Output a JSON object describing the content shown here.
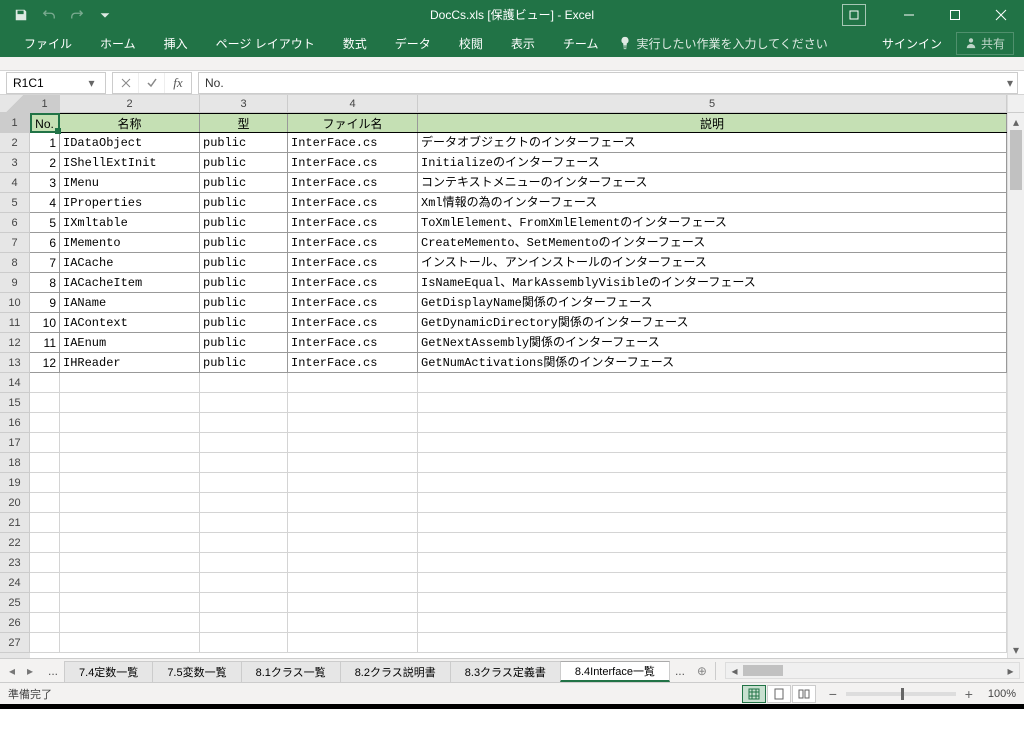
{
  "title": "DocCs.xls [保護ビュー] - Excel",
  "qat": {
    "save": "save",
    "undo": "undo",
    "redo": "redo"
  },
  "window": {
    "minimize": "minimize",
    "maximize": "maximize",
    "close": "close"
  },
  "ribbon": {
    "tabs": [
      "ファイル",
      "ホーム",
      "挿入",
      "ページ レイアウト",
      "数式",
      "データ",
      "校閲",
      "表示",
      "チーム"
    ],
    "tellme": "実行したい作業を入力してください",
    "signin": "サインイン",
    "share": "共有"
  },
  "formula": {
    "namebox": "R1C1",
    "content": "No."
  },
  "columns": [
    "1",
    "2",
    "3",
    "4",
    "5"
  ],
  "headers": {
    "no": "No.",
    "name": "名称",
    "type": "型",
    "file": "ファイル名",
    "desc": "説明"
  },
  "rows": [
    {
      "no": "1",
      "name": "IDataObject",
      "type": "public",
      "file": "InterFace.cs",
      "desc": "データオブジェクトのインターフェース"
    },
    {
      "no": "2",
      "name": "IShellExtInit",
      "type": "public",
      "file": "InterFace.cs",
      "desc": "Initializeのインターフェース"
    },
    {
      "no": "3",
      "name": "IMenu",
      "type": "public",
      "file": "InterFace.cs",
      "desc": "コンテキストメニューのインターフェース"
    },
    {
      "no": "4",
      "name": "IProperties",
      "type": "public",
      "file": "InterFace.cs",
      "desc": "Xml情報の為のインターフェース"
    },
    {
      "no": "5",
      "name": "IXmltable",
      "type": "public",
      "file": "InterFace.cs",
      "desc": "ToXmlElement、FromXmlElementのインターフェース"
    },
    {
      "no": "6",
      "name": "IMemento",
      "type": "public",
      "file": "InterFace.cs",
      "desc": "CreateMemento、SetMementoのインターフェース"
    },
    {
      "no": "7",
      "name": "IACache",
      "type": "public",
      "file": "InterFace.cs",
      "desc": "インストール、アンインストールのインターフェース"
    },
    {
      "no": "8",
      "name": "IACacheItem",
      "type": "public",
      "file": "InterFace.cs",
      "desc": "IsNameEqual、MarkAssemblyVisibleのインターフェース"
    },
    {
      "no": "9",
      "name": "IAName",
      "type": "public",
      "file": "InterFace.cs",
      "desc": "GetDisplayName関係のインターフェース"
    },
    {
      "no": "10",
      "name": "IAContext",
      "type": "public",
      "file": "InterFace.cs",
      "desc": "GetDynamicDirectory関係のインターフェース"
    },
    {
      "no": "11",
      "name": "IAEnum",
      "type": "public",
      "file": "InterFace.cs",
      "desc": "GetNextAssembly関係のインターフェース"
    },
    {
      "no": "12",
      "name": "IHReader",
      "type": "public",
      "file": "InterFace.cs",
      "desc": "GetNumActivations関係のインターフェース"
    }
  ],
  "emptyRows": 14,
  "sheets": {
    "ellipsis": "...",
    "tabs": [
      "7.4定数一覧",
      "7.5変数一覧",
      "8.1クラス一覧",
      "8.2クラス説明書",
      "8.3クラス定義書",
      "8.4Interface一覧"
    ],
    "active": "8.4Interface一覧",
    "more": "..."
  },
  "status": {
    "ready": "準備完了",
    "zoom": "100%"
  }
}
